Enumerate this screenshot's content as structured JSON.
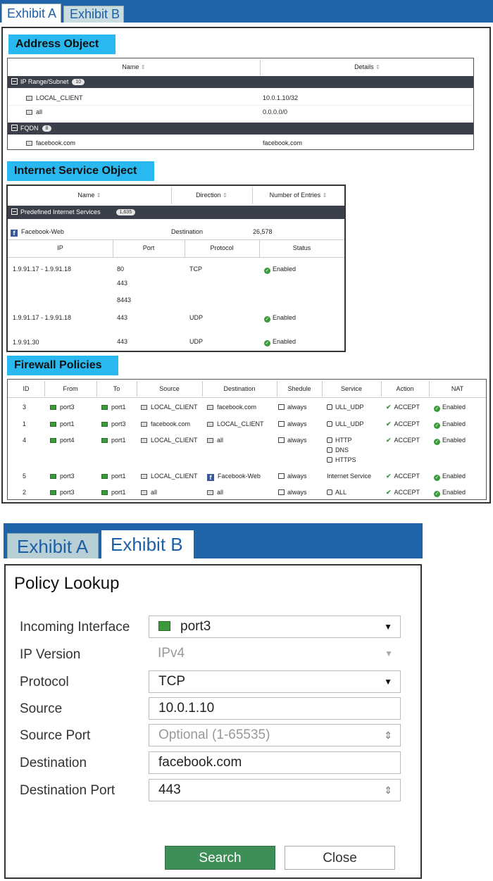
{
  "exhibit_a": {
    "tabs": [
      "Exhibit A",
      "Exhibit B"
    ],
    "address_object": {
      "title": "Address Object",
      "columns": [
        "Name",
        "Details"
      ],
      "groups": [
        {
          "name": "IP Range/Subnet",
          "count": "10",
          "rows": [
            {
              "name": "LOCAL_CLIENT",
              "details": "10.0.1.10/32"
            },
            {
              "name": "all",
              "details": "0.0.0.0/0"
            }
          ]
        },
        {
          "name": "FQDN",
          "count": "8",
          "rows": [
            {
              "name": "facebook.com",
              "details": "facebook.com"
            }
          ]
        }
      ]
    },
    "internet_service_object": {
      "title": "Internet Service Object",
      "columns": [
        "Name",
        "Direction",
        "Number of Entries"
      ],
      "group": {
        "name": "Predefined Internet Services",
        "count": "1,635"
      },
      "service": {
        "name": "Facebook-Web",
        "direction": "Destination",
        "entries": "26,578"
      },
      "sub_columns": [
        "IP",
        "Port",
        "Protocol",
        "Status"
      ],
      "rows": [
        {
          "ip": "1.9.91.17 - 1.9.91.18",
          "ports": [
            "80",
            "443",
            "8443"
          ],
          "protocol": "TCP",
          "status": "Enabled"
        },
        {
          "ip": "1.9.91.17 - 1.9.91.18",
          "ports": [
            "443"
          ],
          "protocol": "UDP",
          "status": "Enabled"
        },
        {
          "ip": "1.9.91.30",
          "ports": [
            "443"
          ],
          "protocol": "UDP",
          "status": "Enabled"
        }
      ]
    },
    "firewall_policies": {
      "title": "Firewall Policies",
      "columns": [
        "ID",
        "From",
        "To",
        "Source",
        "Destination",
        "Shedule",
        "Service",
        "Action",
        "NAT"
      ],
      "rows": [
        {
          "id": "3",
          "from": "port3",
          "to": "port1",
          "source": "LOCAL_CLIENT",
          "destination": "facebook.com",
          "schedule": "always",
          "services": [
            "ULL_UDP"
          ],
          "action": "ACCEPT",
          "nat": "Enabled"
        },
        {
          "id": "1",
          "from": "port1",
          "to": "port3",
          "source": "facebook.com",
          "destination": "LOCAL_CLIENT",
          "schedule": "always",
          "services": [
            "ULL_UDP"
          ],
          "action": "ACCEPT",
          "nat": "Enabled"
        },
        {
          "id": "4",
          "from": "port4",
          "to": "port1",
          "source": "LOCAL_CLIENT",
          "destination": "all",
          "schedule": "always",
          "services": [
            "HTTP",
            "DNS",
            "HTTPS"
          ],
          "action": "ACCEPT",
          "nat": "Enabled"
        },
        {
          "id": "5",
          "from": "port3",
          "to": "port1",
          "source": "LOCAL_CLIENT",
          "destination": "Facebook-Web",
          "schedule": "always",
          "services": [
            "Internet Service"
          ],
          "action": "ACCEPT",
          "nat": "Enabled"
        },
        {
          "id": "2",
          "from": "port3",
          "to": "port1",
          "source": "all",
          "destination": "all",
          "schedule": "always",
          "services": [
            "ALL"
          ],
          "action": "ACCEPT",
          "nat": "Enabled"
        }
      ]
    }
  },
  "exhibit_b": {
    "tabs": [
      "Exhibit A",
      "Exhibit B"
    ],
    "title": "Policy Lookup",
    "fields": {
      "incoming_interface": {
        "label": "Incoming Interface",
        "value": "port3"
      },
      "ip_version": {
        "label": "IP Version",
        "value": "IPv4"
      },
      "protocol": {
        "label": "Protocol",
        "value": "TCP"
      },
      "source": {
        "label": "Source",
        "value": "10.0.1.10"
      },
      "source_port": {
        "label": "Source Port",
        "placeholder": "Optional (1-65535)"
      },
      "destination": {
        "label": "Destination",
        "value": "facebook.com"
      },
      "destination_port": {
        "label": "Destination Port",
        "value": "443"
      }
    },
    "buttons": {
      "search": "Search",
      "close": "Close"
    },
    "colors": {
      "tab_bar": "#1f63a8",
      "search_button": "#3e8e57",
      "section_label": "#29b8ef"
    }
  }
}
